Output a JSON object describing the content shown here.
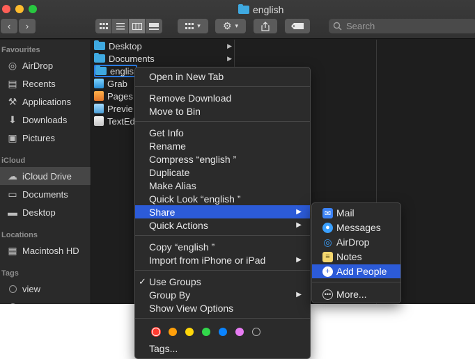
{
  "window": {
    "title": "english"
  },
  "toolbar": {
    "back_icon": "chevron-left-icon",
    "forward_icon": "chevron-right-icon",
    "view_modes": [
      "icon-view-icon",
      "list-view-icon",
      "column-view-icon",
      "gallery-view-icon"
    ],
    "group_icon": "group-grid-icon",
    "action_icon": "gear-icon",
    "share_icon": "share-icon",
    "tag_icon": "tag-icon",
    "search_placeholder": "Search"
  },
  "sidebar": {
    "favourites_header": "Favourites",
    "favourites": [
      {
        "label": "AirDrop",
        "icon": "airdrop-icon"
      },
      {
        "label": "Recents",
        "icon": "recents-icon"
      },
      {
        "label": "Applications",
        "icon": "applications-icon"
      },
      {
        "label": "Downloads",
        "icon": "downloads-icon"
      },
      {
        "label": "Pictures",
        "icon": "pictures-icon"
      }
    ],
    "icloud_header": "iCloud",
    "icloud": [
      {
        "label": "iCloud Drive",
        "icon": "cloud-icon"
      },
      {
        "label": "Documents",
        "icon": "document-icon"
      },
      {
        "label": "Desktop",
        "icon": "desktop-icon"
      }
    ],
    "locations_header": "Locations",
    "locations": [
      {
        "label": "Macintosh HD",
        "icon": "disk-icon"
      }
    ],
    "tags_header": "Tags",
    "tags": [
      {
        "label": "view",
        "icon": "tag-circle-icon"
      }
    ]
  },
  "column1": {
    "files": [
      {
        "label": "Desktop",
        "icon": "folder-icon"
      },
      {
        "label": "Documents",
        "icon": "folder-icon"
      },
      {
        "label": "englis",
        "icon": "folder-icon"
      },
      {
        "label": "Grab",
        "icon": "app-icon"
      },
      {
        "label": "Pages",
        "icon": "app-icon"
      },
      {
        "label": "Previe",
        "icon": "app-icon"
      },
      {
        "label": "TextEd",
        "icon": "app-icon"
      }
    ]
  },
  "context_menu": {
    "items": [
      "Open in New Tab",
      "Remove Download",
      "Move to Bin",
      "Get Info",
      "Rename",
      "Compress “english ”",
      "Duplicate",
      "Make Alias",
      "Quick Look “english ”",
      "Share",
      "Quick Actions",
      "Copy “english ”",
      "Import from iPhone or iPad",
      "Use Groups",
      "Group By",
      "Show View Options",
      "Tags..."
    ],
    "submenu_arrow": "▶",
    "checkmark": "✓",
    "tag_colors": [
      "#ff3b30",
      "#ff9f0a",
      "#ffd60a",
      "#32d74b",
      "#0a84ff",
      "#bf5af2",
      "#8e8e93"
    ]
  },
  "share_menu": {
    "items": [
      {
        "label": "Mail",
        "icon": "mail-icon"
      },
      {
        "label": "Messages",
        "icon": "messages-icon"
      },
      {
        "label": "AirDrop",
        "icon": "airdrop-icon"
      },
      {
        "label": "Notes",
        "icon": "notes-icon"
      },
      {
        "label": "Add People",
        "icon": "add-people-icon"
      },
      {
        "label": "More...",
        "icon": "more-icon"
      }
    ]
  }
}
